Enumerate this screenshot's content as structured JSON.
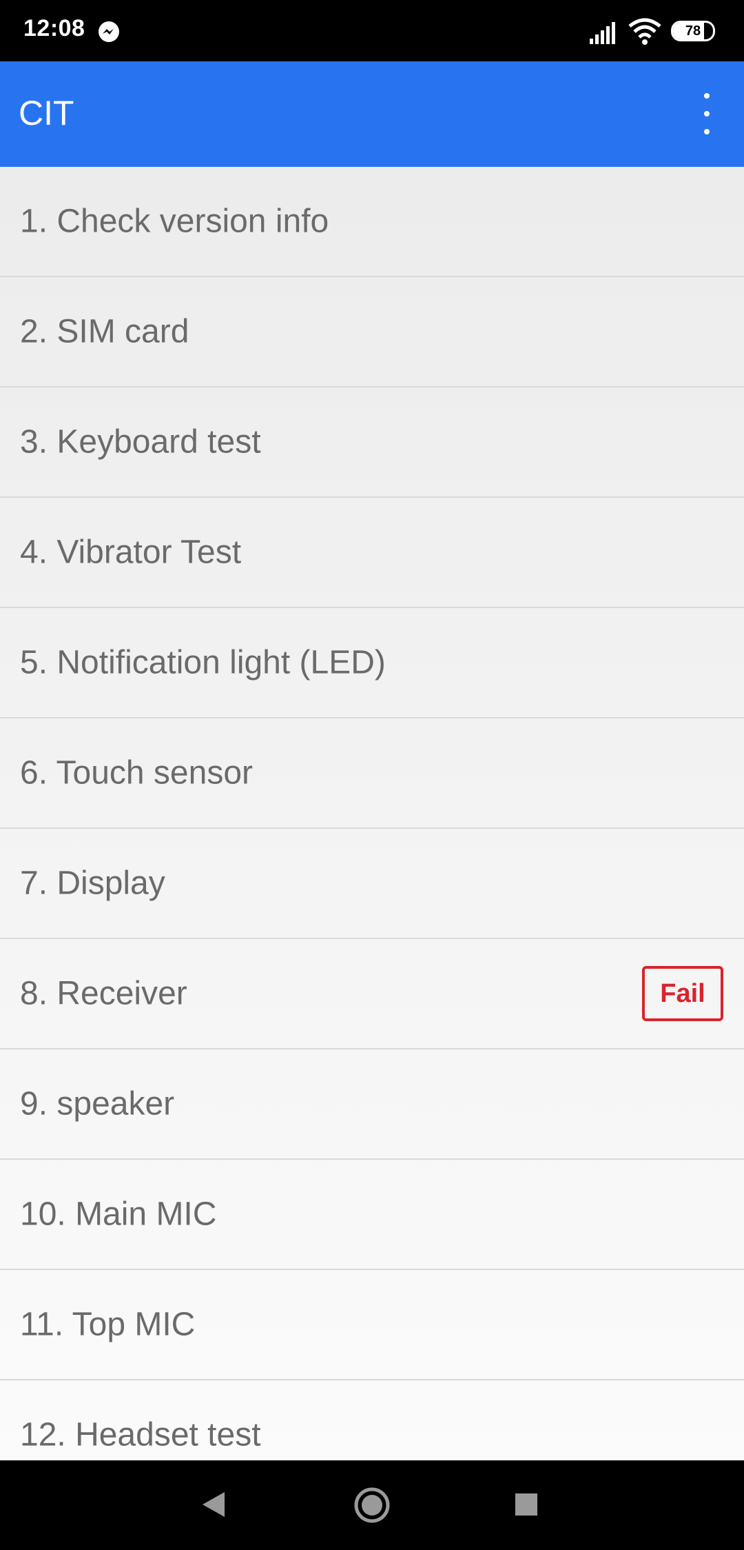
{
  "status_bar": {
    "time": "12:08",
    "battery_level": "78",
    "battery_fraction": 0.78,
    "icons": [
      "messenger-icon",
      "signal-icon",
      "wifi-icon",
      "battery-icon"
    ]
  },
  "app_bar": {
    "title": "CIT",
    "menu_icon": "overflow-menu-icon"
  },
  "colors": {
    "app_bar": "#2874f0",
    "fail": "#d9232c",
    "item_text": "#6a6a6a"
  },
  "test_list": {
    "items": [
      {
        "label": "1. Check version info",
        "status": ""
      },
      {
        "label": "2. SIM card",
        "status": ""
      },
      {
        "label": "3. Keyboard test",
        "status": ""
      },
      {
        "label": "4. Vibrator Test",
        "status": ""
      },
      {
        "label": "5. Notification light (LED)",
        "status": ""
      },
      {
        "label": "6. Touch sensor",
        "status": ""
      },
      {
        "label": "7. Display",
        "status": ""
      },
      {
        "label": "8. Receiver",
        "status": "Fail"
      },
      {
        "label": "9. speaker",
        "status": ""
      },
      {
        "label": "10. Main MIC",
        "status": ""
      },
      {
        "label": "11. Top MIC",
        "status": ""
      },
      {
        "label": "12. Headset test",
        "status": ""
      }
    ]
  },
  "nav_bar": {
    "icons": [
      "back-icon",
      "home-icon",
      "recents-icon"
    ]
  }
}
